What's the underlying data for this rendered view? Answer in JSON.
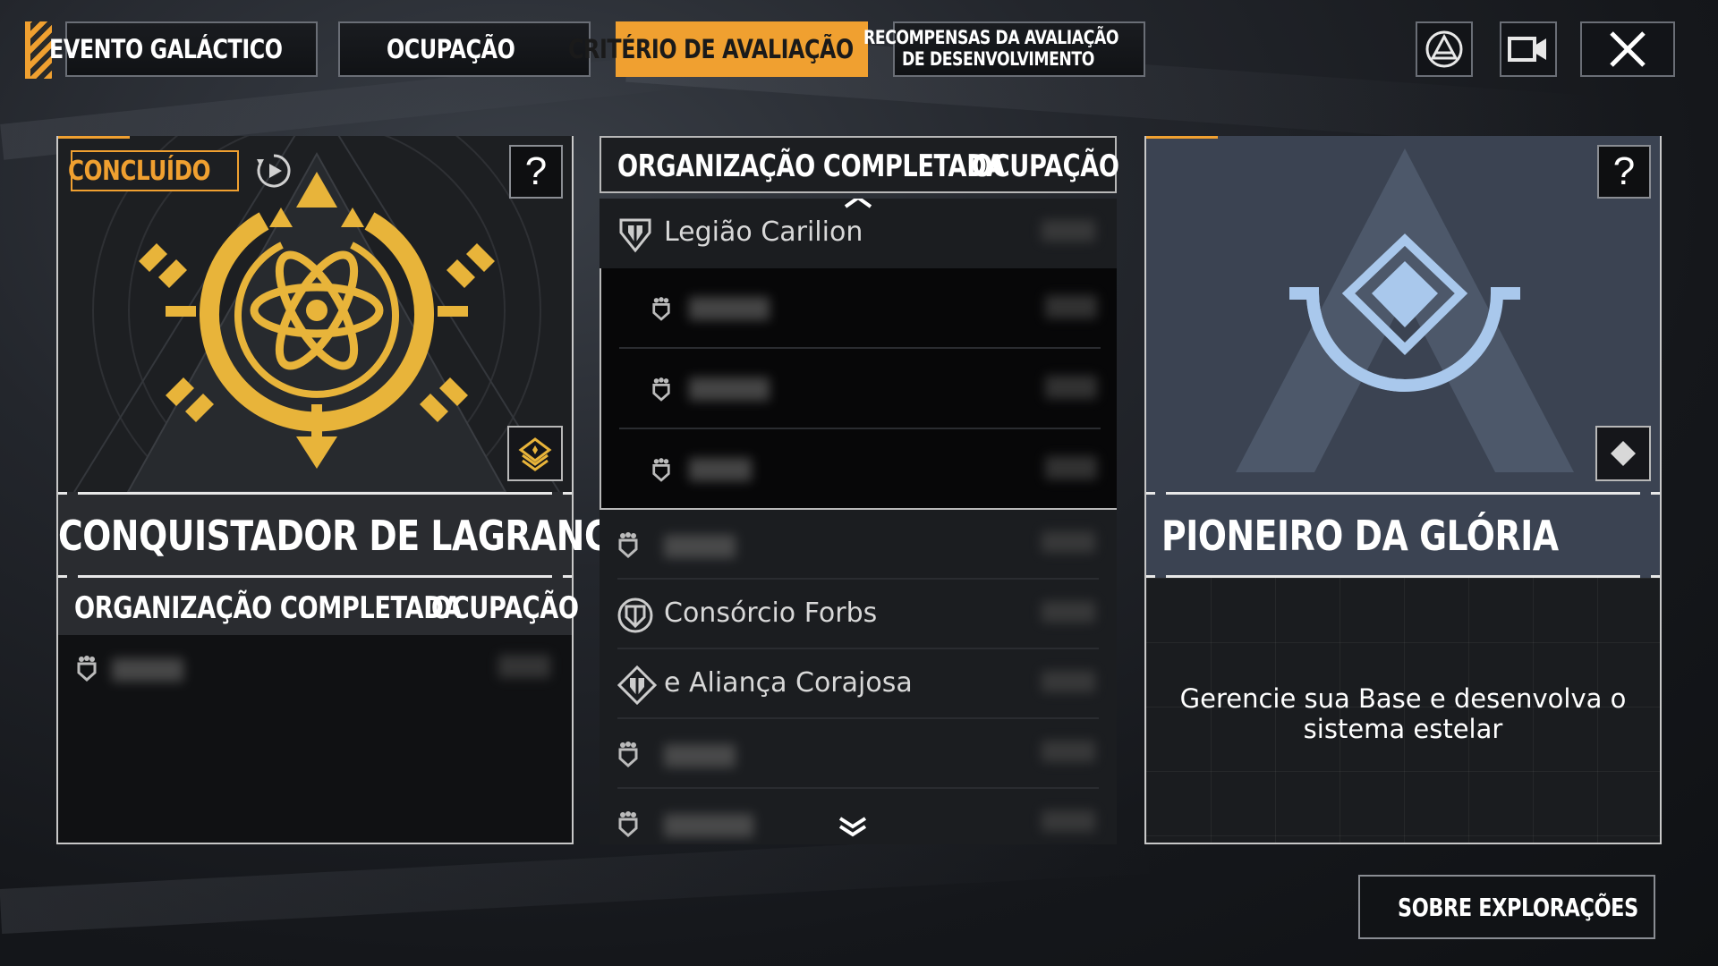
{
  "tabs": [
    {
      "label": "EVENTO GALÁCTICO",
      "active": false
    },
    {
      "label": "OCUPAÇÃO",
      "active": false
    },
    {
      "label": "CRITÉRIO DE AVALIAÇÃO",
      "active": true
    },
    {
      "label_line1": "RECOMPENSAS DA AVALIAÇÃO",
      "label_line2": "DE DESENVOLVIMENTO",
      "active": false
    }
  ],
  "left_card": {
    "status_badge": "CONCLUÍDO",
    "help": "?",
    "title": "CONQUISTADOR DE LAGRANGE",
    "col_org": "ORGANIZAÇÃO COMPLETADA",
    "col_occ": "OCUPAÇÃO"
  },
  "middle_list": {
    "col_org": "ORGANIZAÇÃO COMPLETADA",
    "col_occ": "OCUPAÇÃO",
    "rows": [
      {
        "name": "Legião Carilion"
      },
      {
        "name": "Consórcio Forbs"
      },
      {
        "name": "e Aliança Corajosa"
      }
    ]
  },
  "right_card": {
    "help": "?",
    "title": "PIONEIRO DA GLÓRIA",
    "description": "Gerencie sua Base e desenvolva o sistema estelar"
  },
  "explore_button": {
    "label": "SOBRE EXPLORAÇÕES"
  },
  "colors": {
    "accent": "#f0a030",
    "gold": "#e8b43a",
    "pale_blue": "#a9c8ec"
  },
  "icons": [
    "triangle-logo-icon",
    "video-camera-icon",
    "close-icon",
    "replay-icon",
    "warning-icon",
    "rank-badge-icon",
    "diamond-icon",
    "shield-icon"
  ]
}
